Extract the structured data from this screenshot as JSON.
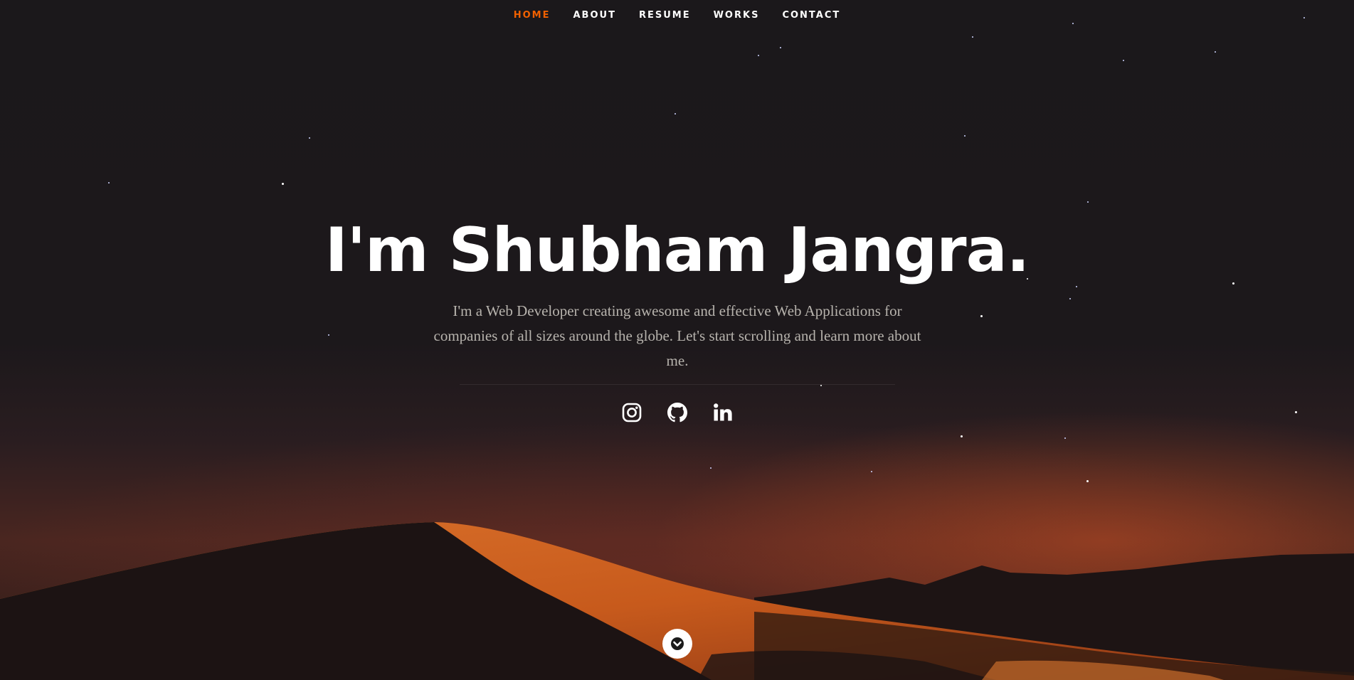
{
  "nav": {
    "items": [
      {
        "label": "HOME",
        "active": true
      },
      {
        "label": "ABOUT",
        "active": false
      },
      {
        "label": "RESUME",
        "active": false
      },
      {
        "label": "WORKS",
        "active": false
      },
      {
        "label": "CONTACT",
        "active": false
      }
    ],
    "active_color": "#f06000"
  },
  "hero": {
    "title": "I'm Shubham Jangra.",
    "subtitle": "I'm a Web Developer creating awesome and effective Web Applications for companies of all sizes around the globe. Let's start scrolling and learn more about me."
  },
  "social": {
    "icons": [
      "instagram-icon",
      "github-icon",
      "linkedin-icon"
    ]
  },
  "scroll_icon": "chevron-down-icon"
}
